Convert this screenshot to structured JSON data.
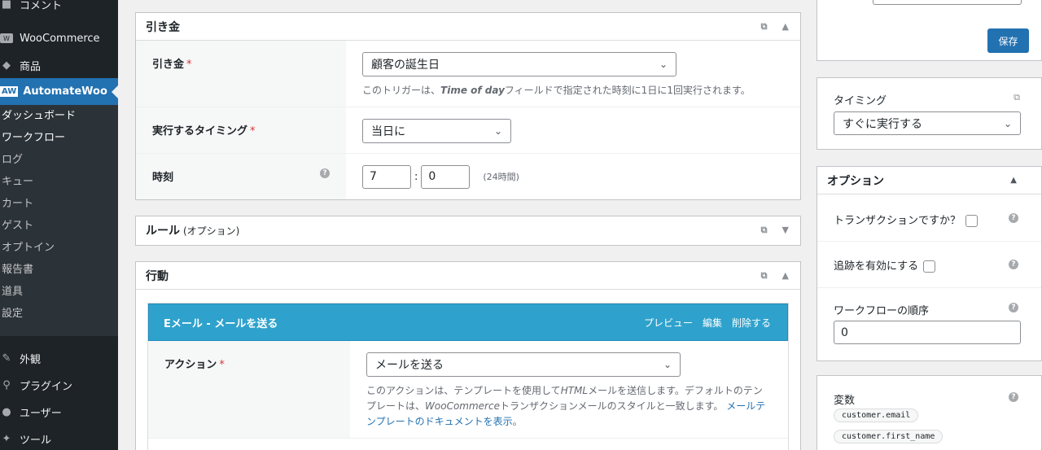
{
  "sidebar": {
    "comments": "コメント",
    "woocommerce": "WooCommerce",
    "products": "商品",
    "automatewoo": "AutomateWoo",
    "aw_badge": "AW",
    "submenu": [
      "ダッシュボード",
      "ワークフロー",
      "ログ",
      "キュー",
      "カート",
      "ゲスト",
      "オプトイン",
      "報告書",
      "道具",
      "設定"
    ],
    "appearance": "外観",
    "plugins": "プラグイン",
    "users": "ユーザー",
    "tools": "ツール"
  },
  "trigger": {
    "title": "引き金",
    "trigger_label": "引き金",
    "trigger_value": "顧客の誕生日",
    "trigger_desc_pre": "このトリガーは、",
    "trigger_desc_em": "Time of day",
    "trigger_desc_post": "フィールドで指定された時刻に1日に1回実行されます。",
    "timing_label": "実行するタイミング",
    "timing_value": "当日に",
    "time_label": "時刻",
    "hour": "7",
    "minute": "0",
    "time_sep": ":",
    "time_note": "(24時間)"
  },
  "rules": {
    "title": "ルール",
    "subtitle": "(オプション)"
  },
  "actions": {
    "title": "行動",
    "email_title": "Eメール - メールを送る",
    "preview": "プレビュー",
    "edit": "編集",
    "delete": "削除する",
    "action_label": "アクション",
    "action_value": "メールを送る",
    "desc_1": "このアクションは、テンプレートを使用して",
    "desc_html": "HTML",
    "desc_2": "メールを送信します。デフォルトのテンプレートは、",
    "desc_wc": "WooCommerce",
    "desc_3": "トランザクションメールのスタイルと一致します。",
    "desc_link": "メールテンプレートのドキュメントを表示",
    "desc_end": "。"
  },
  "save": {
    "label": "保存"
  },
  "timing_box": {
    "title": "タイミング",
    "value": "すぐに実行する"
  },
  "options": {
    "title": "オプション",
    "transactional": "トランザクションですか？",
    "tracking": "追跡を有効にする",
    "order_label": "ワークフローの順序",
    "order_value": "0"
  },
  "variables": {
    "title": "変数",
    "items": [
      "customer.email",
      "customer.first_name"
    ]
  },
  "icons": {
    "help": "?",
    "chevron": "⌄",
    "up": "▲",
    "down": "▼",
    "external": "⧉"
  },
  "colors": {
    "accent": "#2271b1",
    "email_header": "#2ea2cc",
    "sidebar": "#1d2327"
  }
}
